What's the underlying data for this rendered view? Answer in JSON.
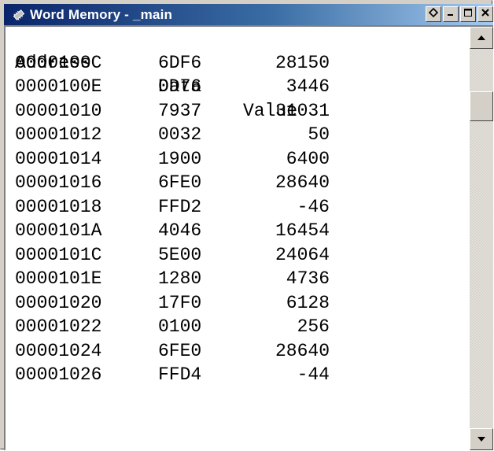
{
  "window": {
    "title": "Word Memory - _main",
    "icon": "memory-chip-icon",
    "buttons": [
      "restore-icon",
      "minimize-icon",
      "maximize-icon",
      "close-icon"
    ],
    "colors": {
      "title_start": "#0a246a",
      "title_end": "#a6caf0",
      "face": "#d4d0c8"
    }
  },
  "table": {
    "headers": {
      "address": "Address",
      "data": "Data",
      "value": "Value"
    },
    "rows": [
      {
        "address": "0000100C",
        "data": "6DF6",
        "value": "28150"
      },
      {
        "address": "0000100E",
        "data": "0D76",
        "value": "3446"
      },
      {
        "address": "00001010",
        "data": "7937",
        "value": "31031"
      },
      {
        "address": "00001012",
        "data": "0032",
        "value": "50"
      },
      {
        "address": "00001014",
        "data": "1900",
        "value": "6400"
      },
      {
        "address": "00001016",
        "data": "6FE0",
        "value": "28640"
      },
      {
        "address": "00001018",
        "data": "FFD2",
        "value": "-46"
      },
      {
        "address": "0000101A",
        "data": "4046",
        "value": "16454"
      },
      {
        "address": "0000101C",
        "data": "5E00",
        "value": "24064"
      },
      {
        "address": "0000101E",
        "data": "1280",
        "value": "4736"
      },
      {
        "address": "00001020",
        "data": "17F0",
        "value": "6128"
      },
      {
        "address": "00001022",
        "data": "0100",
        "value": "256"
      },
      {
        "address": "00001024",
        "data": "6FE0",
        "value": "28640"
      },
      {
        "address": "00001026",
        "data": "FFD4",
        "value": "-44"
      }
    ]
  },
  "scrollbar": {
    "up_icon": "arrow-up-icon",
    "down_icon": "arrow-down-icon"
  }
}
